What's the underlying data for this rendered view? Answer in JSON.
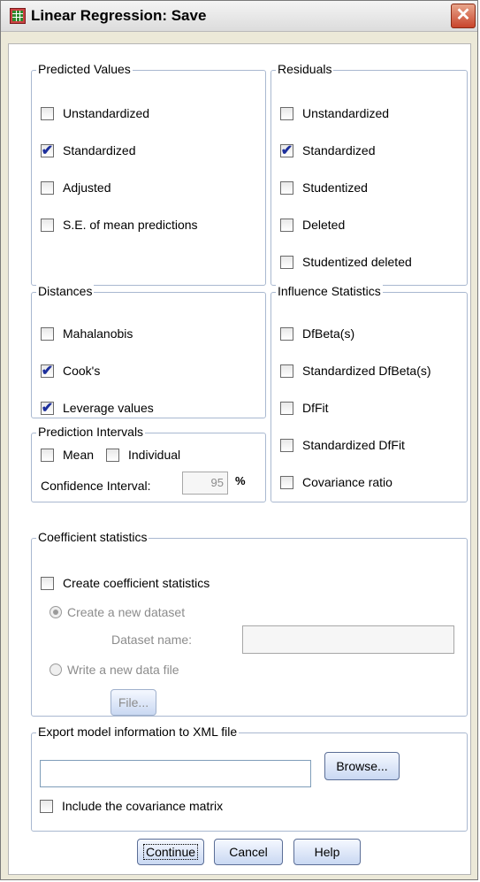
{
  "window": {
    "title": "Linear Regression: Save",
    "close_glyph": "✕"
  },
  "predicted": {
    "legend": "Predicted Values",
    "items": [
      {
        "label": "Unstandardized",
        "checked": false
      },
      {
        "label": "Standardized",
        "checked": true
      },
      {
        "label": "Adjusted",
        "checked": false
      },
      {
        "label": "S.E. of mean predictions",
        "checked": false
      }
    ]
  },
  "residuals": {
    "legend": "Residuals",
    "items": [
      {
        "label": "Unstandardized",
        "checked": false
      },
      {
        "label": "Standardized",
        "checked": true
      },
      {
        "label": "Studentized",
        "checked": false
      },
      {
        "label": "Deleted",
        "checked": false
      },
      {
        "label": "Studentized deleted",
        "checked": false
      }
    ]
  },
  "distances": {
    "legend": "Distances",
    "items": [
      {
        "label": "Mahalanobis",
        "checked": false
      },
      {
        "label": "Cook's",
        "checked": true
      },
      {
        "label": "Leverage values",
        "checked": true
      }
    ]
  },
  "influence": {
    "legend": "Influence Statistics",
    "items": [
      {
        "label": "DfBeta(s)",
        "checked": false
      },
      {
        "label": "Standardized DfBeta(s)",
        "checked": false
      },
      {
        "label": "DfFit",
        "checked": false
      },
      {
        "label": "Standardized DfFit",
        "checked": false
      },
      {
        "label": "Covariance ratio",
        "checked": false
      }
    ]
  },
  "intervals": {
    "legend": "Prediction Intervals",
    "mean_label": "Mean",
    "individual_label": "Individual",
    "ci_label": "Confidence Interval:",
    "ci_value": "95",
    "ci_unit": "%"
  },
  "coef": {
    "legend": "Coefficient statistics",
    "create_label": "Create coefficient statistics",
    "new_dataset_label": "Create a new dataset",
    "dataset_name_label": "Dataset name:",
    "dataset_name_value": "",
    "new_file_label": "Write a new data file",
    "file_button": "File..."
  },
  "export": {
    "legend": "Export model information to XML file",
    "path_value": "",
    "browse_button": "Browse...",
    "include_cov_label": "Include the covariance matrix"
  },
  "footer": {
    "continue": "Continue",
    "cancel": "Cancel",
    "help": "Help"
  },
  "colors": {
    "check": "#1d2f9c",
    "group_border": "#a9b8d0",
    "close": "#c8442b"
  }
}
